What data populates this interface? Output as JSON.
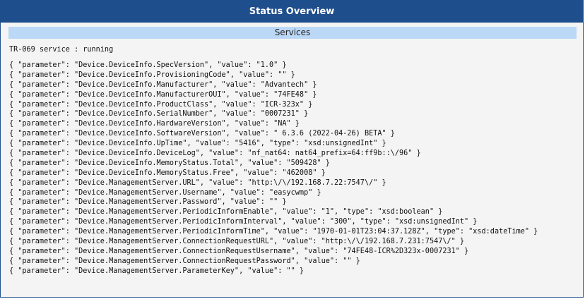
{
  "header": {
    "title": "Status Overview"
  },
  "section": {
    "title": "Services"
  },
  "service_status": "TR-069 service : running",
  "parameters": [
    "{ \"parameter\": \"Device.DeviceInfo.SpecVersion\", \"value\": \"1.0\" }",
    "{ \"parameter\": \"Device.DeviceInfo.ProvisioningCode\", \"value\": \"\" }",
    "{ \"parameter\": \"Device.DeviceInfo.Manufacturer\", \"value\": \"Advantech\" }",
    "{ \"parameter\": \"Device.DeviceInfo.ManufacturerOUI\", \"value\": \"74FE48\" }",
    "{ \"parameter\": \"Device.DeviceInfo.ProductClass\", \"value\": \"ICR-323x\" }",
    "{ \"parameter\": \"Device.DeviceInfo.SerialNumber\", \"value\": \"0007231\" }",
    "{ \"parameter\": \"Device.DeviceInfo.HardwareVersion\", \"value\": \"NA\" }",
    "{ \"parameter\": \"Device.DeviceInfo.SoftwareVersion\", \"value\": \" 6.3.6 (2022-04-26) BETA\" }",
    "{ \"parameter\": \"Device.DeviceInfo.UpTime\", \"value\": \"5416\", \"type\": \"xsd:unsignedInt\" }",
    "{ \"parameter\": \"Device.DeviceInfo.DeviceLog\", \"value\": \"nf_nat64: nat64_prefix=64:ff9b::\\/96\" }",
    "{ \"parameter\": \"Device.DeviceInfo.MemoryStatus.Total\", \"value\": \"509428\" }",
    "{ \"parameter\": \"Device.DeviceInfo.MemoryStatus.Free\", \"value\": \"462008\" }",
    "{ \"parameter\": \"Device.ManagementServer.URL\", \"value\": \"http:\\/\\/192.168.7.22:7547\\/\" }",
    "{ \"parameter\": \"Device.ManagementServer.Username\", \"value\": \"easycwmp\" }",
    "{ \"parameter\": \"Device.ManagementServer.Password\", \"value\": \"\" }",
    "{ \"parameter\": \"Device.ManagementServer.PeriodicInformEnable\", \"value\": \"1\", \"type\": \"xsd:boolean\" }",
    "{ \"parameter\": \"Device.ManagementServer.PeriodicInformInterval\", \"value\": \"300\", \"type\": \"xsd:unsignedInt\" }",
    "{ \"parameter\": \"Device.ManagementServer.PeriodicInformTime\", \"value\": \"1970-01-01T23:04:37.128Z\", \"type\": \"xsd:dateTime\" }",
    "{ \"parameter\": \"Device.ManagementServer.ConnectionRequestURL\", \"value\": \"http:\\/\\/192.168.7.231:7547\\/\" }",
    "{ \"parameter\": \"Device.ManagementServer.ConnectionRequestUsername\", \"value\": \"74FE48-ICR%2D323x-0007231\" }",
    "{ \"parameter\": \"Device.ManagementServer.ConnectionRequestPassword\", \"value\": \"\" }",
    "{ \"parameter\": \"Device.ManagementServer.ParameterKey\", \"value\": \"\" }"
  ]
}
